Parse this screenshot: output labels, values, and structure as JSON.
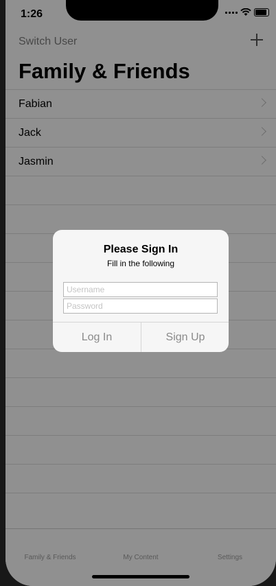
{
  "status_bar": {
    "time": "1:26"
  },
  "nav": {
    "left_label": "Switch User",
    "add_icon": "plus-icon",
    "title": "Family & Friends"
  },
  "list": {
    "items": [
      {
        "label": "Fabian"
      },
      {
        "label": "Jack"
      },
      {
        "label": "Jasmin"
      }
    ],
    "empty_row_count": 12
  },
  "tabs": [
    {
      "label": "Family & Friends"
    },
    {
      "label": "My Content"
    },
    {
      "label": "Settings"
    }
  ],
  "alert": {
    "title": "Please Sign In",
    "message": "Fill in the following",
    "username_placeholder": "Username",
    "password_placeholder": "Password",
    "buttons": [
      {
        "label": "Log In"
      },
      {
        "label": "Sign Up"
      }
    ]
  },
  "colors": {
    "overlay": "#000000",
    "dialog_bg": "#f6f6f6",
    "button_text": "#8a8a8a"
  }
}
